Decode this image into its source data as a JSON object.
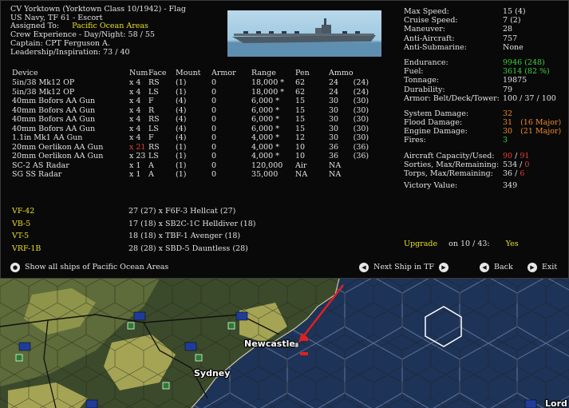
{
  "header": {
    "lines": [
      "CV Yorktown (Yorktown Class 10/1942) - Flag",
      "US Navy, TF 61 - Escort"
    ],
    "assigned_label": "Assigned To:",
    "assigned_value": "Pacific Ocean Areas",
    "crew_experience": "Crew Experience - Day/Night:  58 / 55",
    "captain": "Captain:  CPT Ferguson A.",
    "leadership": "Leadership/Inspiration: 73 / 40"
  },
  "ship_photo_icon": "carrier-photo",
  "devices": {
    "columns": [
      "Device",
      "Num",
      "Face",
      "Mount",
      "Armor",
      "Range",
      "Pen",
      "Ammo"
    ],
    "rows": [
      {
        "device": "5in/38 Mk12 OP",
        "num": "x 4",
        "face": "RS",
        "mount": "(1)",
        "armor": "0",
        "range": "18,000 *",
        "pen": "62",
        "ammo": "24",
        "ammo_max": "(24)"
      },
      {
        "device": "5in/38 Mk12 OP",
        "num": "x 4",
        "face": "LS",
        "mount": "(1)",
        "armor": "0",
        "range": "18,000 *",
        "pen": "62",
        "ammo": "24",
        "ammo_max": "(24)"
      },
      {
        "device": "40mm Bofors AA Gun",
        "num": "x 4",
        "face": "F",
        "mount": "(4)",
        "armor": "0",
        "range": "6,000 *",
        "pen": "15",
        "ammo": "30",
        "ammo_max": "(30)"
      },
      {
        "device": "40mm Bofors AA Gun",
        "num": "x 4",
        "face": "R",
        "mount": "(4)",
        "armor": "0",
        "range": "6,000 *",
        "pen": "15",
        "ammo": "30",
        "ammo_max": "(30)"
      },
      {
        "device": "40mm Bofors AA Gun",
        "num": "x 4",
        "face": "RS",
        "mount": "(4)",
        "armor": "0",
        "range": "6,000 *",
        "pen": "15",
        "ammo": "30",
        "ammo_max": "(30)"
      },
      {
        "device": "40mm Bofors AA Gun",
        "num": "x 4",
        "face": "LS",
        "mount": "(4)",
        "armor": "0",
        "range": "6,000 *",
        "pen": "15",
        "ammo": "30",
        "ammo_max": "(30)"
      },
      {
        "device": "1.1in Mk1 AA Gun",
        "num": "x 4",
        "face": "F",
        "mount": "(4)",
        "armor": "0",
        "range": "4,000 *",
        "pen": "12",
        "ammo": "30",
        "ammo_max": "(30)"
      },
      {
        "device": "20mm Oerlikon AA Gun",
        "num": "x 21",
        "num_damaged": true,
        "face": "RS",
        "mount": "(1)",
        "armor": "0",
        "range": "4,000 *",
        "pen": "10",
        "ammo": "36",
        "ammo_max": "(36)"
      },
      {
        "device": "20mm Oerlikon AA Gun",
        "num": "x 23",
        "face": "LS",
        "mount": "(1)",
        "armor": "0",
        "range": "4,000 *",
        "pen": "10",
        "ammo": "36",
        "ammo_max": "(36)"
      },
      {
        "device": "SC-2 AS Radar",
        "num": "x 1",
        "face": "A",
        "mount": "(1)",
        "armor": "0",
        "range": "120,000",
        "pen": "Air",
        "ammo": "NA",
        "ammo_max": ""
      },
      {
        "device": "SG SS Radar",
        "num": "x 1",
        "face": "A",
        "mount": "(1)",
        "armor": "0",
        "range": "35,000",
        "pen": "NA",
        "ammo": "NA",
        "ammo_max": ""
      }
    ]
  },
  "air_group": [
    {
      "unit": "VF-42",
      "detail": "27 (27) x F6F-3 Hellcat (27)"
    },
    {
      "unit": "VB-5",
      "detail": "17 (18) x SB2C-1C Helldiver (18)"
    },
    {
      "unit": "VT-5",
      "detail": "18 (18) x TBF-1 Avenger (18)"
    },
    {
      "unit": "VRF-1B",
      "detail": "28 (28) x SBD-5 Dauntless (28)"
    }
  ],
  "stats": {
    "block1": [
      {
        "label": "Max Speed:",
        "value": "15 (4)",
        "color": "#e2e2e2"
      },
      {
        "label": "Cruise Speed:",
        "value": "7 (2)",
        "color": "#e2e2e2"
      },
      {
        "label": "Maneuver:",
        "value": "28",
        "color": "#e2e2e2"
      },
      {
        "label": "Anti-Aircraft:",
        "value": "757",
        "color": "#e2e2e2"
      },
      {
        "label": "Anti-Submarine:",
        "value": "None",
        "color": "#e2e2e2"
      }
    ],
    "block2": [
      {
        "label": "Endurance:",
        "value": "9946 (248)",
        "color": "#3fd23f"
      },
      {
        "label": "Fuel:",
        "value": "3614 (82 %)",
        "color": "#3fd23f"
      },
      {
        "label": "Tonnage:",
        "value": "19875",
        "color": "#e2e2e2"
      },
      {
        "label": "Durability:",
        "value": "79",
        "color": "#e2e2e2"
      },
      {
        "label": "Armor: Belt/Deck/Tower:",
        "value": "100 / 37 / 100",
        "color": "#e2e2e2"
      }
    ],
    "block3": [
      {
        "label": "System Damage:",
        "value": "32",
        "color": "#f08a2a",
        "extra": ""
      },
      {
        "label": "Flood Damage:",
        "value": "31",
        "color": "#f08a2a",
        "extra": "(16 Major)"
      },
      {
        "label": "Engine Damage:",
        "value": "30",
        "color": "#f08a2a",
        "extra": "(21 Major)"
      },
      {
        "label": "Fires:",
        "value": "3",
        "color": "#3fd23f",
        "extra": ""
      }
    ],
    "aircraft_capacity": {
      "label": "Aircraft Capacity/Used:",
      "a": "90",
      "b": "91"
    },
    "sorties": {
      "label": "Sorties, Max/Remaining:",
      "a": "534",
      "b": "0"
    },
    "torps": {
      "label": "Torps, Max/Remaining:",
      "a": "36",
      "b": "6"
    },
    "victory_value": {
      "label": "Victory Value:",
      "value": "349"
    }
  },
  "upgrade": {
    "label": "Upgrade",
    "on": "on  10 / 43:",
    "value": "Yes"
  },
  "buttons": {
    "show_all": "Show all ships of Pacific Ocean Areas",
    "next_ship": "Next Ship in TF",
    "back": "Back",
    "exit": "Exit"
  },
  "map": {
    "towns": {
      "newcastle": "Newcastle",
      "sydney": "Sydney",
      "lord": "Lord"
    },
    "colors": {
      "ocean": "#1e3358",
      "hex_line": "#5d6f92",
      "land": "#3c4a2c",
      "arrow": "#e02020"
    }
  }
}
